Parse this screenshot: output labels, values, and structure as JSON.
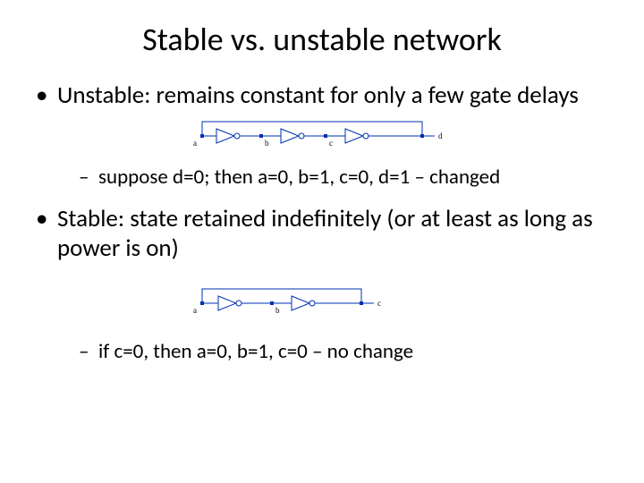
{
  "title": "Stable vs. unstable network",
  "bullets": {
    "unstable": "Unstable: remains constant for only a few gate delays",
    "unstable_sub": "suppose d=0; then a=0, b=1, c=0, d=1 – changed",
    "stable": "Stable: state retained indefinitely (or at least as long as power is on)",
    "stable_sub": "if c=0, then a=0, b=1, c=0 – no change"
  },
  "fig1": {
    "a": "a",
    "b": "b",
    "c": "c",
    "d": "d"
  },
  "fig2": {
    "a": "a",
    "b": "b",
    "c": "c"
  }
}
